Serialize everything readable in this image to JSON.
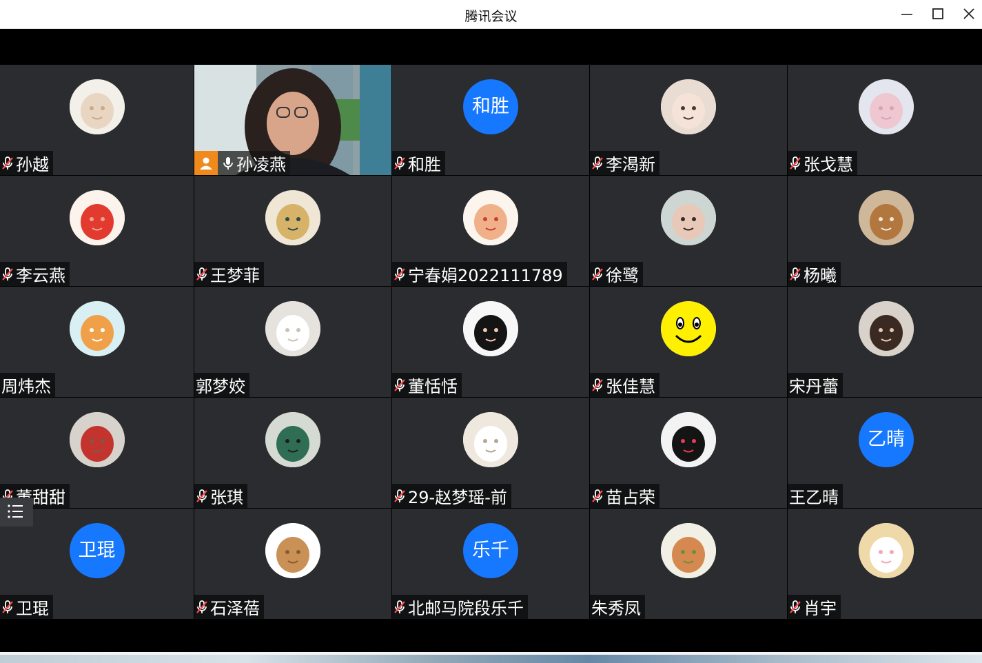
{
  "window": {
    "title": "腾讯会议"
  },
  "participants": [
    {
      "name": "孙越",
      "muted": true,
      "avatar_type": "image",
      "avatar_icon": "cat-avatar-icon"
    },
    {
      "name": "孙凌燕",
      "muted": false,
      "avatar_type": "video",
      "host": true
    },
    {
      "name": "和胜",
      "muted": true,
      "avatar_type": "text",
      "avatar_text": "和胜"
    },
    {
      "name": "李渴新",
      "muted": true,
      "avatar_type": "image",
      "avatar_icon": "girl-photo-avatar-icon"
    },
    {
      "name": "张戈慧",
      "muted": true,
      "avatar_type": "image",
      "avatar_icon": "pink-bear-avatar-icon"
    },
    {
      "name": "李云燕",
      "muted": true,
      "avatar_type": "image",
      "avatar_icon": "red-can-avatar-icon"
    },
    {
      "name": "王梦菲",
      "muted": true,
      "avatar_type": "image",
      "avatar_icon": "painting-avatar-icon"
    },
    {
      "name": "宁春娟2022111789",
      "muted": true,
      "avatar_type": "image",
      "avatar_icon": "cartoon-girl-fish-avatar-icon"
    },
    {
      "name": "徐鹭",
      "muted": true,
      "avatar_type": "image",
      "avatar_icon": "woman-photo-avatar-icon"
    },
    {
      "name": "杨曦",
      "muted": true,
      "avatar_type": "image",
      "avatar_icon": "dog-antlers-avatar-icon"
    },
    {
      "name": "周炜杰",
      "muted": false,
      "avatar_type": "image",
      "avatar_icon": "corgi-avatar-icon"
    },
    {
      "name": "郭梦姣",
      "muted": false,
      "avatar_type": "image",
      "avatar_icon": "samoyed-avatar-icon"
    },
    {
      "name": "董恬恬",
      "muted": true,
      "avatar_type": "image",
      "avatar_icon": "cartoon-girl-avatar-icon"
    },
    {
      "name": "张佳慧",
      "muted": true,
      "avatar_type": "image",
      "avatar_icon": "smiley-avatar-icon"
    },
    {
      "name": "宋丹蕾",
      "muted": false,
      "avatar_type": "image",
      "avatar_icon": "fur-hat-avatar-icon"
    },
    {
      "name": "董甜甜",
      "muted": true,
      "avatar_type": "image",
      "avatar_icon": "man-cap-avatar-icon"
    },
    {
      "name": "张琪",
      "muted": true,
      "avatar_type": "image",
      "avatar_icon": "woman-green-avatar-icon"
    },
    {
      "name": "29-赵梦瑶-前",
      "muted": true,
      "avatar_type": "image",
      "avatar_icon": "puppy-avatar-icon"
    },
    {
      "name": "苗占荣",
      "muted": true,
      "avatar_type": "image",
      "avatar_icon": "maruko-avatar-icon"
    },
    {
      "name": "王乙晴",
      "muted": false,
      "avatar_type": "text",
      "avatar_text": "乙晴"
    },
    {
      "name": "卫琨",
      "muted": true,
      "avatar_type": "text",
      "avatar_text": "卫琨"
    },
    {
      "name": "石泽蓓",
      "muted": true,
      "avatar_type": "image",
      "avatar_icon": "lion-plush-avatar-icon"
    },
    {
      "name": "北邮马院段乐千",
      "muted": true,
      "avatar_type": "text",
      "avatar_text": "乐千"
    },
    {
      "name": "朱秀凤",
      "muted": false,
      "avatar_type": "image",
      "avatar_icon": "house-avatar-icon"
    },
    {
      "name": "肖宇",
      "muted": true,
      "avatar_type": "image",
      "avatar_icon": "rabbit-avatar-icon"
    }
  ]
}
